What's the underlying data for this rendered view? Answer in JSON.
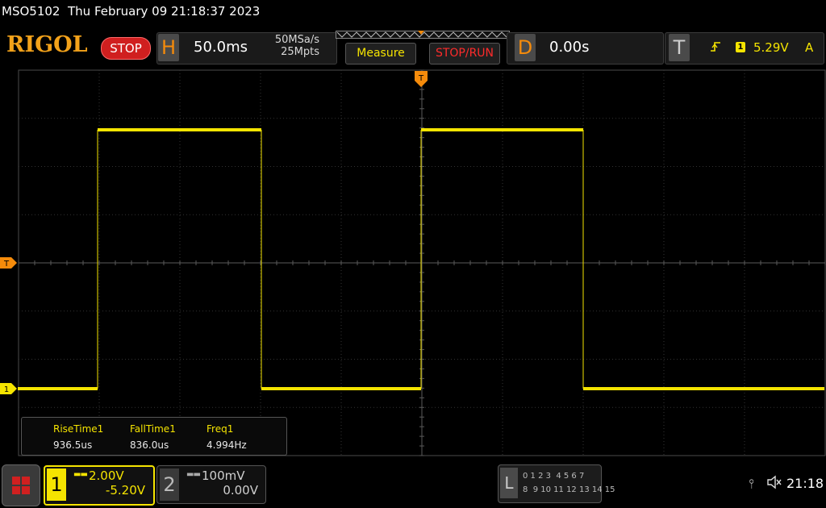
{
  "header": {
    "model": "MSO5102",
    "datetime": "Thu February 09 21:18:37 2023"
  },
  "brand": {
    "logo": "RIGOL",
    "run_state": "STOP"
  },
  "horizontal": {
    "letter": "H",
    "timebase": "50.0ms",
    "sample_rate": "50MSa/s",
    "memory_depth": "25Mpts"
  },
  "buttons": {
    "measure": "Measure",
    "stop_run": "STOP/RUN"
  },
  "delay": {
    "letter": "D",
    "value": "0.00s"
  },
  "trigger": {
    "letter": "T",
    "channel": "1",
    "level": "5.29V",
    "mode": "A",
    "edge": "rising"
  },
  "markers": {
    "trigger_top": "T",
    "trigger_left": "T",
    "ch1_ground": "1"
  },
  "measurements": {
    "headers": [
      "RiseTime1",
      "FallTime1",
      "Freq1"
    ],
    "values": [
      "936.5us",
      "836.0us",
      "4.994Hz"
    ]
  },
  "channel1": {
    "number": "1",
    "scale": "2.00V",
    "offset": "-5.20V"
  },
  "channel2": {
    "number": "2",
    "scale": "100mV",
    "offset": "0.00V"
  },
  "logic": {
    "letter": "L",
    "row1": "0 1 2 3  4 5 6 7",
    "row2": "8  9 10 11 12 13 14 15"
  },
  "status": {
    "clock": "21:18"
  },
  "colors": {
    "ch1": "#f5e400",
    "accent": "#f58b0b",
    "stop": "#d01f1f",
    "grid": "#3a3a3a"
  }
}
